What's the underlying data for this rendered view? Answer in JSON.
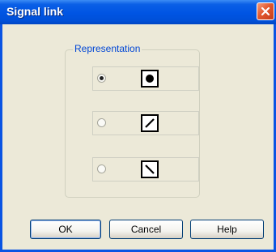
{
  "window": {
    "title": "Signal link"
  },
  "group": {
    "legend": "Representation",
    "options": [
      {
        "selected": true,
        "icon": "filled-circle-icon"
      },
      {
        "selected": false,
        "icon": "forward-slash-icon"
      },
      {
        "selected": false,
        "icon": "back-slash-icon"
      }
    ]
  },
  "buttons": {
    "ok": "OK",
    "cancel": "Cancel",
    "help": "Help"
  },
  "colors": {
    "titlebar": "#0054e3",
    "dialog_bg": "#ece9d8",
    "close": "#e2582f",
    "legend_text": "#0046d5"
  }
}
